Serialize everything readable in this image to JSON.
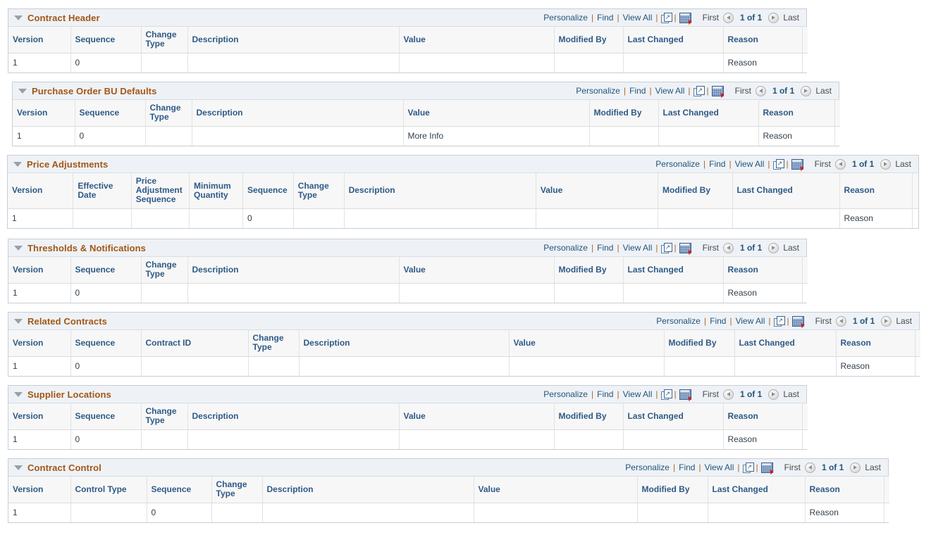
{
  "toolbar": {
    "personalize": "Personalize",
    "find": "Find",
    "view_all": "View All",
    "separator": "|",
    "newwin_icon": "new-window-icon",
    "grid_icon": "download-to-spreadsheet-icon"
  },
  "pager": {
    "first": "First",
    "count": "1 of 1",
    "last": "Last",
    "prev_icon": "previous-arrow-icon",
    "next_icon": "next-arrow-icon"
  },
  "colors": {
    "section_title": "#a35616",
    "column_header": "#2e5a86",
    "link": "#24557a",
    "title_band": "#eef2f6",
    "header_row": "#f7f7f7",
    "border": "#c8ced4"
  },
  "sections": [
    {
      "id": "contract-header",
      "title": "Contract Header",
      "columns": [
        "Version",
        "Sequence",
        "Change Type",
        "Description",
        "Value",
        "Modified By",
        "Last Changed",
        "Reason",
        ""
      ],
      "rows": [
        [
          "1",
          "0",
          "",
          "",
          "",
          "",
          "",
          "Reason",
          ""
        ]
      ]
    },
    {
      "id": "purchase-order-bu-defaults",
      "title": "Purchase Order BU Defaults",
      "columns": [
        "Version",
        "Sequence",
        "Change Type",
        "Description",
        "Value",
        "Modified By",
        "Last Changed",
        "Reason",
        ""
      ],
      "rows": [
        [
          "1",
          "0",
          "",
          "",
          "More Info",
          "",
          "",
          "Reason",
          ""
        ]
      ]
    },
    {
      "id": "price-adjustments",
      "title": "Price Adjustments",
      "columns": [
        "Version",
        "Effective Date",
        "Price Adjustment Sequence",
        "Minimum Quantity",
        "Sequence",
        "Change Type",
        "Description",
        "Value",
        "Modified By",
        "Last Changed",
        "Reason",
        ""
      ],
      "rows": [
        [
          "1",
          "",
          "",
          "",
          "0",
          "",
          "",
          "",
          "",
          "",
          "Reason",
          ""
        ]
      ]
    },
    {
      "id": "thresholds-and-notifications",
      "title": "Thresholds & Notifications",
      "columns": [
        "Version",
        "Sequence",
        "Change Type",
        "Description",
        "Value",
        "Modified By",
        "Last Changed",
        "Reason",
        ""
      ],
      "rows": [
        [
          "1",
          "0",
          "",
          "",
          "",
          "",
          "",
          "Reason",
          ""
        ]
      ]
    },
    {
      "id": "related-contracts",
      "title": "Related Contracts",
      "columns": [
        "Version",
        "Sequence",
        "Contract ID",
        "Change Type",
        "Description",
        "Value",
        "Modified By",
        "Last Changed",
        "Reason",
        ""
      ],
      "rows": [
        [
          "1",
          "0",
          "",
          "",
          "",
          "",
          "",
          "",
          "Reason",
          ""
        ]
      ]
    },
    {
      "id": "supplier-locations",
      "title": "Supplier Locations",
      "columns": [
        "Version",
        "Sequence",
        "Change Type",
        "Description",
        "Value",
        "Modified By",
        "Last Changed",
        "Reason",
        ""
      ],
      "rows": [
        [
          "1",
          "0",
          "",
          "",
          "",
          "",
          "",
          "Reason",
          ""
        ]
      ]
    },
    {
      "id": "contract-control",
      "title": "Contract Control",
      "columns": [
        "Version",
        "Control Type",
        "Sequence",
        "Change Type",
        "Description",
        "Value",
        "Modified By",
        "Last Changed",
        "Reason",
        ""
      ],
      "rows": [
        [
          "1",
          "",
          "0",
          "",
          "",
          "",
          "",
          "",
          "Reason",
          ""
        ]
      ]
    }
  ]
}
